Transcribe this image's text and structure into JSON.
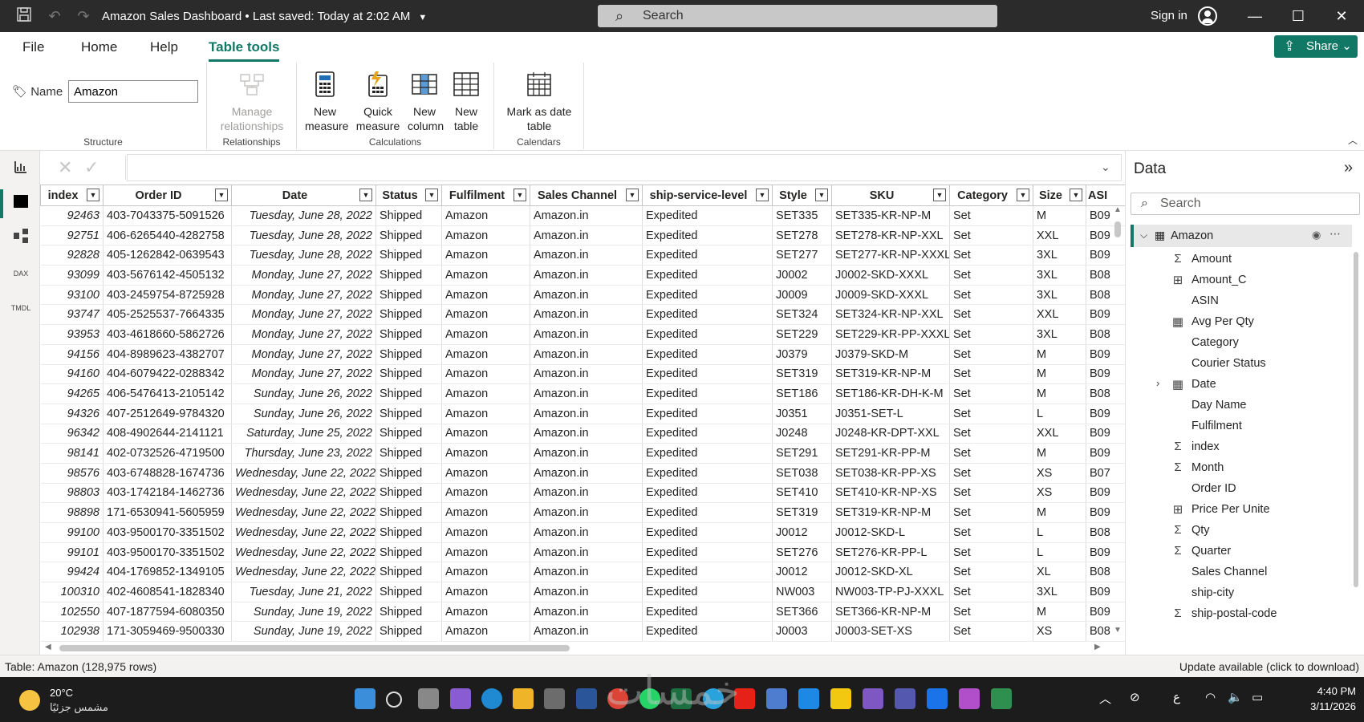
{
  "titlebar": {
    "title": "Amazon Sales Dashboard • Last saved: Today at 2:02 AM",
    "search_placeholder": "Search",
    "signin_label": "Sign in"
  },
  "menu": {
    "items": [
      "File",
      "Home",
      "Help",
      "Table tools"
    ],
    "active": "Table tools",
    "share_label": "Share"
  },
  "ribbon": {
    "name_label": "Name",
    "name_value": "Amazon",
    "structure_label": "Structure",
    "manage_relationships_label": "Manage relationships",
    "relationships_label": "Relationships",
    "new_measure_label": "New measure",
    "quick_measure_label": "Quick measure",
    "new_column_label": "New column",
    "new_table_label": "New table",
    "calculations_label": "Calculations",
    "mark_date_table_label": "Mark as date table",
    "calendars_label": "Calendars"
  },
  "grid": {
    "columns": [
      "index",
      "Order ID",
      "Date",
      "Status",
      "Fulfilment",
      "Sales Channel",
      "ship-service-level",
      "Style",
      "SKU",
      "Category",
      "Size",
      "ASI"
    ],
    "rows": [
      [
        "92463",
        "403-7043375-5091526",
        "Tuesday, June 28, 2022",
        "Shipped",
        "Amazon",
        "Amazon.in",
        "Expedited",
        "SET335",
        "SET335-KR-NP-M",
        "Set",
        "M",
        "B09"
      ],
      [
        "92751",
        "406-6265440-4282758",
        "Tuesday, June 28, 2022",
        "Shipped",
        "Amazon",
        "Amazon.in",
        "Expedited",
        "SET278",
        "SET278-KR-NP-XXL",
        "Set",
        "XXL",
        "B09"
      ],
      [
        "92828",
        "405-1262842-0639543",
        "Tuesday, June 28, 2022",
        "Shipped",
        "Amazon",
        "Amazon.in",
        "Expedited",
        "SET277",
        "SET277-KR-NP-XXXL",
        "Set",
        "3XL",
        "B09"
      ],
      [
        "93099",
        "403-5676142-4505132",
        "Monday, June 27, 2022",
        "Shipped",
        "Amazon",
        "Amazon.in",
        "Expedited",
        "J0002",
        "J0002-SKD-XXXL",
        "Set",
        "3XL",
        "B08"
      ],
      [
        "93100",
        "403-2459754-8725928",
        "Monday, June 27, 2022",
        "Shipped",
        "Amazon",
        "Amazon.in",
        "Expedited",
        "J0009",
        "J0009-SKD-XXXL",
        "Set",
        "3XL",
        "B08"
      ],
      [
        "93747",
        "405-2525537-7664335",
        "Monday, June 27, 2022",
        "Shipped",
        "Amazon",
        "Amazon.in",
        "Expedited",
        "SET324",
        "SET324-KR-NP-XXL",
        "Set",
        "XXL",
        "B09"
      ],
      [
        "93953",
        "403-4618660-5862726",
        "Monday, June 27, 2022",
        "Shipped",
        "Amazon",
        "Amazon.in",
        "Expedited",
        "SET229",
        "SET229-KR-PP-XXXL",
        "Set",
        "3XL",
        "B08"
      ],
      [
        "94156",
        "404-8989623-4382707",
        "Monday, June 27, 2022",
        "Shipped",
        "Amazon",
        "Amazon.in",
        "Expedited",
        "J0379",
        "J0379-SKD-M",
        "Set",
        "M",
        "B09"
      ],
      [
        "94160",
        "404-6079422-0288342",
        "Monday, June 27, 2022",
        "Shipped",
        "Amazon",
        "Amazon.in",
        "Expedited",
        "SET319",
        "SET319-KR-NP-M",
        "Set",
        "M",
        "B09"
      ],
      [
        "94265",
        "406-5476413-2105142",
        "Sunday, June 26, 2022",
        "Shipped",
        "Amazon",
        "Amazon.in",
        "Expedited",
        "SET186",
        "SET186-KR-DH-K-M",
        "Set",
        "M",
        "B08"
      ],
      [
        "94326",
        "407-2512649-9784320",
        "Sunday, June 26, 2022",
        "Shipped",
        "Amazon",
        "Amazon.in",
        "Expedited",
        "J0351",
        "J0351-SET-L",
        "Set",
        "L",
        "B09"
      ],
      [
        "96342",
        "408-4902644-2141121",
        "Saturday, June 25, 2022",
        "Shipped",
        "Amazon",
        "Amazon.in",
        "Expedited",
        "J0248",
        "J0248-KR-DPT-XXL",
        "Set",
        "XXL",
        "B09"
      ],
      [
        "98141",
        "402-0732526-4719500",
        "Thursday, June 23, 2022",
        "Shipped",
        "Amazon",
        "Amazon.in",
        "Expedited",
        "SET291",
        "SET291-KR-PP-M",
        "Set",
        "M",
        "B09"
      ],
      [
        "98576",
        "403-6748828-1674736",
        "Wednesday, June 22, 2022",
        "Shipped",
        "Amazon",
        "Amazon.in",
        "Expedited",
        "SET038",
        "SET038-KR-PP-XS",
        "Set",
        "XS",
        "B07"
      ],
      [
        "98803",
        "403-1742184-1462736",
        "Wednesday, June 22, 2022",
        "Shipped",
        "Amazon",
        "Amazon.in",
        "Expedited",
        "SET410",
        "SET410-KR-NP-XS",
        "Set",
        "XS",
        "B09"
      ],
      [
        "98898",
        "171-6530941-5605959",
        "Wednesday, June 22, 2022",
        "Shipped",
        "Amazon",
        "Amazon.in",
        "Expedited",
        "SET319",
        "SET319-KR-NP-M",
        "Set",
        "M",
        "B09"
      ],
      [
        "99100",
        "403-9500170-3351502",
        "Wednesday, June 22, 2022",
        "Shipped",
        "Amazon",
        "Amazon.in",
        "Expedited",
        "J0012",
        "J0012-SKD-L",
        "Set",
        "L",
        "B08"
      ],
      [
        "99101",
        "403-9500170-3351502",
        "Wednesday, June 22, 2022",
        "Shipped",
        "Amazon",
        "Amazon.in",
        "Expedited",
        "SET276",
        "SET276-KR-PP-L",
        "Set",
        "L",
        "B09"
      ],
      [
        "99424",
        "404-1769852-1349105",
        "Wednesday, June 22, 2022",
        "Shipped",
        "Amazon",
        "Amazon.in",
        "Expedited",
        "J0012",
        "J0012-SKD-XL",
        "Set",
        "XL",
        "B08"
      ],
      [
        "100310",
        "402-4608541-1828340",
        "Tuesday, June 21, 2022",
        "Shipped",
        "Amazon",
        "Amazon.in",
        "Expedited",
        "NW003",
        "NW003-TP-PJ-XXXL",
        "Set",
        "3XL",
        "B09"
      ],
      [
        "102550",
        "407-1877594-6080350",
        "Sunday, June 19, 2022",
        "Shipped",
        "Amazon",
        "Amazon.in",
        "Expedited",
        "SET366",
        "SET366-KR-NP-M",
        "Set",
        "M",
        "B09"
      ],
      [
        "102938",
        "171-3059469-9500330",
        "Sunday, June 19, 2022",
        "Shipped",
        "Amazon",
        "Amazon.in",
        "Expedited",
        "J0003",
        "J0003-SET-XS",
        "Set",
        "XS",
        "B08"
      ]
    ]
  },
  "datapane": {
    "title": "Data",
    "search_placeholder": "Search",
    "table_name": "Amazon",
    "fields": [
      {
        "name": "Amount",
        "icon": "sigma"
      },
      {
        "name": "Amount_C",
        "icon": "calc-column"
      },
      {
        "name": "ASIN",
        "icon": "none"
      },
      {
        "name": "Avg Per Qty",
        "icon": "measure"
      },
      {
        "name": "Category",
        "icon": "none"
      },
      {
        "name": "Courier Status",
        "icon": "none"
      },
      {
        "name": "Date",
        "icon": "table",
        "expandable": true
      },
      {
        "name": "Day Name",
        "icon": "none"
      },
      {
        "name": "Fulfilment",
        "icon": "none"
      },
      {
        "name": "index",
        "icon": "sigma"
      },
      {
        "name": "Month",
        "icon": "sigma"
      },
      {
        "name": "Order ID",
        "icon": "none"
      },
      {
        "name": "Price Per Unite",
        "icon": "calc-column"
      },
      {
        "name": "Qty",
        "icon": "sigma"
      },
      {
        "name": "Quarter",
        "icon": "sigma"
      },
      {
        "name": "Sales Channel",
        "icon": "none"
      },
      {
        "name": "ship-city",
        "icon": "none"
      },
      {
        "name": "ship-postal-code",
        "icon": "sigma"
      }
    ]
  },
  "status": {
    "left": "Table: Amazon (128,975 rows)",
    "right": "Update available (click to download)"
  },
  "taskbar": {
    "temperature": "20°C",
    "weather_desc": "مشمس جزئيًا",
    "language": "ع",
    "time": "4:40 PM",
    "date": "3/11/2026"
  },
  "watermark": "خمسات",
  "colors": {
    "accent": "#117865",
    "titlebar": "#2b2b2b",
    "taskbar": "#1c1c1c"
  }
}
